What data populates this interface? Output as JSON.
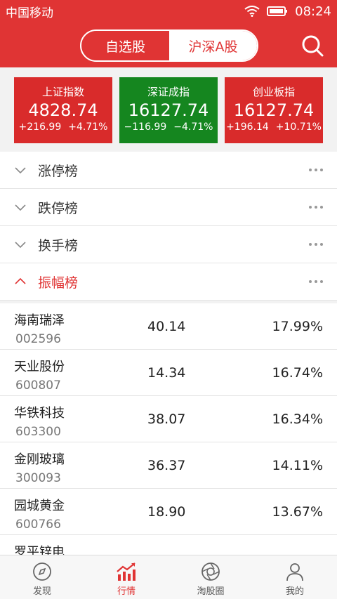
{
  "status": {
    "carrier": "中国移动",
    "time": "08:24"
  },
  "header": {
    "tabs": [
      {
        "label": "自选股"
      },
      {
        "label": "沪深A股"
      }
    ]
  },
  "indices": [
    {
      "name": "上证指数",
      "value": "4828.74",
      "change": "+216.99",
      "percent": "+4.71%",
      "color": "#d92b2b"
    },
    {
      "name": "深证成指",
      "value": "16127.74",
      "change": "−116.99",
      "percent": "−4.71%",
      "color": "#15861f"
    },
    {
      "name": "创业板指",
      "value": "16127.74",
      "change": "+196.14",
      "percent": "+10.71%",
      "color": "#d92b2b"
    }
  ],
  "sections": [
    {
      "label": "涨停榜"
    },
    {
      "label": "跌停榜"
    },
    {
      "label": "换手榜"
    },
    {
      "label": "振幅榜"
    }
  ],
  "stocks": [
    {
      "name": "海南瑞泽",
      "code": "002596",
      "price": "40.14",
      "pct": "17.99%"
    },
    {
      "name": "天业股份",
      "code": "600807",
      "price": "14.34",
      "pct": "16.74%"
    },
    {
      "name": "华铁科技",
      "code": "603300",
      "price": "38.07",
      "pct": "16.34%"
    },
    {
      "name": "金刚玻璃",
      "code": "300093",
      "price": "36.37",
      "pct": "14.11%"
    },
    {
      "name": "园城黄金",
      "code": "600766",
      "price": "18.90",
      "pct": "13.67%"
    },
    {
      "name": "罗平锌电",
      "code": "",
      "price": "",
      "pct": ""
    }
  ],
  "tabbar": [
    {
      "label": "发现",
      "icon": "compass-icon"
    },
    {
      "label": "行情",
      "icon": "chart-icon"
    },
    {
      "label": "淘股圈",
      "icon": "aperture-icon"
    },
    {
      "label": "我的",
      "icon": "user-icon"
    }
  ],
  "colors": {
    "accent": "#e03434",
    "up": "#d92b2b",
    "down": "#15861f"
  }
}
